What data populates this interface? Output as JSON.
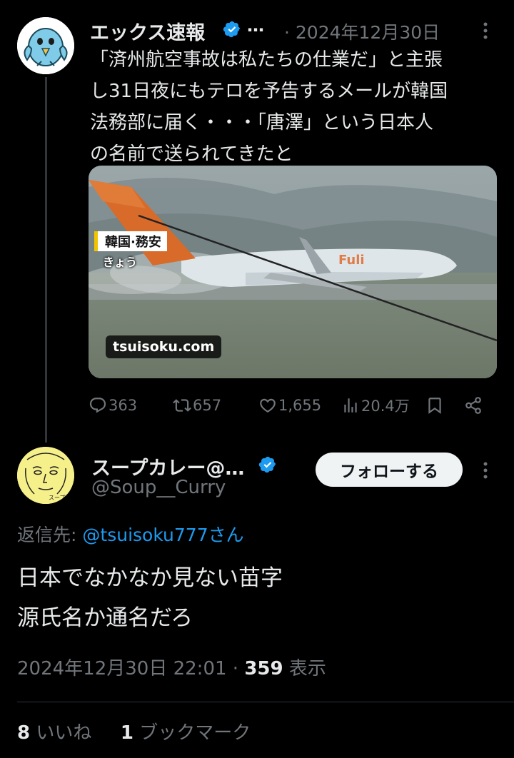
{
  "original_post": {
    "author_name": "エックス速報",
    "author_name_truncation": "…",
    "date": "· 2024年12月30日",
    "text_lines": [
      "「済州航空事故は私たちの仕業だ」と主張",
      "し31日夜にもテロを予告するメールが韓国",
      "法務部に届く・・・「唐澤」という日本人",
      "の名前で送られてきたと"
    ],
    "media": {
      "caption_line1": "韓国·務安",
      "caption_line2": "きょう",
      "watermark": "tsuisoku.com"
    },
    "actions": {
      "replies": "363",
      "reposts": "657",
      "likes": "1,655",
      "views": "20.4万"
    },
    "icons": [
      "avatar-bird",
      "verified-badge",
      "more-icon",
      "reply-icon",
      "repost-icon",
      "like-icon",
      "views-icon",
      "bookmark-icon",
      "share-icon"
    ]
  },
  "reply_post": {
    "author_name": "スープカレー@…",
    "handle": "@Soup__Curry",
    "follow_label": "フォローする",
    "reply_to_label": "返信先:",
    "reply_to_mention": "@tsuisoku777さん",
    "text_lines": [
      "日本でなかなか見ない苗字",
      "源氏名か通名だろ"
    ],
    "timestamp": "2024年12月30日 22:01 · ",
    "view_count": "359",
    "view_label": " 表示",
    "likes_count": "8",
    "likes_label": " いいね",
    "bookmarks_count": "1",
    "bookmarks_label": " ブックマーク",
    "avatar_text": "スープカレ"
  },
  "colors": {
    "background": "#000000",
    "text": "#e7e9ea",
    "muted": "#71767b",
    "accent": "#1d9bf0",
    "verified": "#1d9bf0"
  }
}
